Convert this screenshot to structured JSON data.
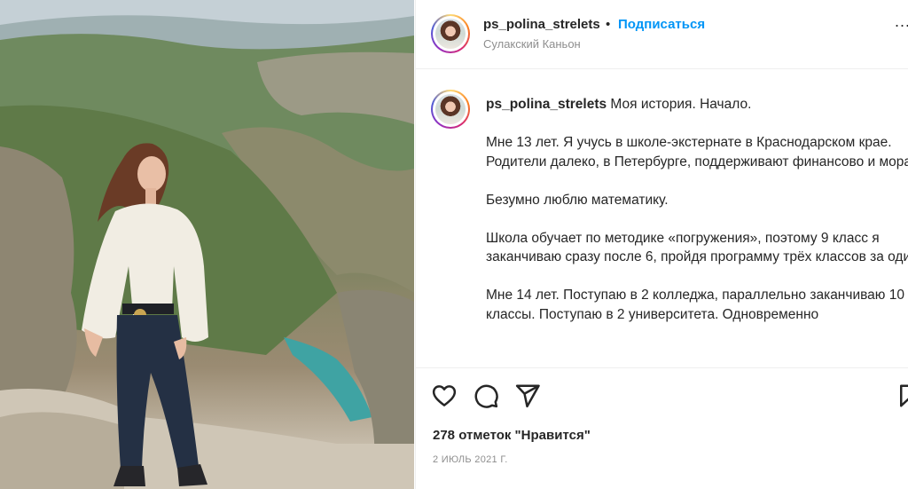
{
  "post": {
    "username": "ps_polina_strelets",
    "separator": "•",
    "follow_label": "Подписаться",
    "location": "Сулакский Каньон",
    "more_label": "..."
  },
  "caption": {
    "username": "ps_polina_strelets",
    "title": "Моя история. Начало.",
    "paragraphs": [
      "Мне 13 лет. Я учусь в школе-экстернате в Краснодарском крае. Родители далеко, в Петербурге, поддерживают финансово и морально.",
      "Безумно люблю математику.",
      "Школа обучает по методике «погружения», поэтому 9 класс я заканчиваю сразу после 6, пройдя программу трёх классов за один год.",
      "Мне 14 лет. Поступаю в 2 колледжа, параллельно заканчиваю 10 и 11 классы. Поступаю в 2 университета. Одновременно"
    ]
  },
  "actions": {
    "like_icon": "heart-icon",
    "comment_icon": "comment-icon",
    "share_icon": "send-icon",
    "save_icon": "bookmark-icon"
  },
  "footer": {
    "likes": "278 отметок \"Нравится\"",
    "date": "2 ИЮЛЬ 2021 Г."
  },
  "colors": {
    "accent": "#0095f6",
    "text": "#262626",
    "muted": "#8e8e8e",
    "border": "#efefef"
  }
}
